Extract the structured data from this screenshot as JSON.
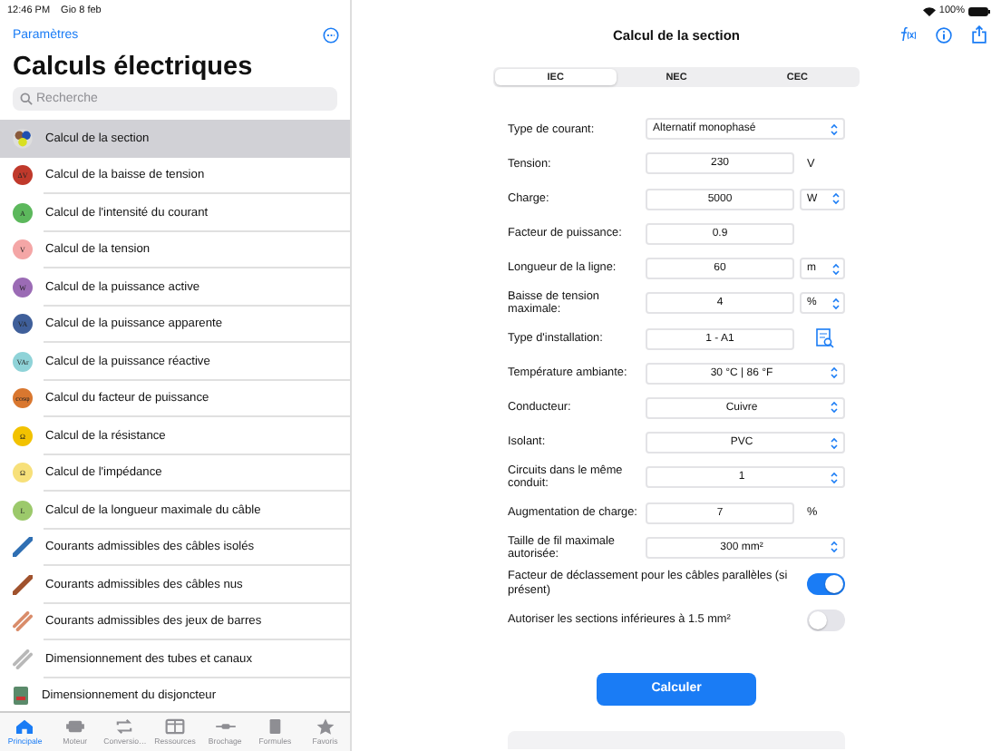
{
  "status_bar": {
    "time": "12:46 PM",
    "date": "Gio 8 feb",
    "battery": "100%"
  },
  "sidebar": {
    "back_link": "Paramètres",
    "title": "Calculs électriques",
    "search": {
      "placeholder": "Recherche"
    },
    "items": [
      {
        "label": "Calcul de la section",
        "kind": "multi",
        "color": "#8a5a3c",
        "selected": true
      },
      {
        "label": "Calcul de la baisse de tension",
        "kind": "badge",
        "symbol": "ΔV",
        "color": "#c0392b",
        "selected": false
      },
      {
        "label": "Calcul de l'intensité du courant",
        "kind": "badge",
        "symbol": "A",
        "color": "#5cb85c",
        "selected": false
      },
      {
        "label": "Calcul de la tension",
        "kind": "badge",
        "symbol": "V",
        "color": "#f4a6a6",
        "selected": false
      },
      {
        "label": "Calcul de la puissance active",
        "kind": "badge",
        "symbol": "W",
        "color": "#9b6bb5",
        "selected": false
      },
      {
        "label": "Calcul de la puissance apparente",
        "kind": "badge",
        "symbol": "VA",
        "color": "#3f5f9a",
        "selected": false
      },
      {
        "label": "Calcul de la puissance réactive",
        "kind": "badge",
        "symbol": "VAr",
        "color": "#8fd3d8",
        "selected": false
      },
      {
        "label": "Calcul du facteur de puissance",
        "kind": "badge",
        "symbol": "cosφ",
        "color": "#d9772f",
        "selected": false
      },
      {
        "label": "Calcul de la résistance",
        "kind": "badge",
        "symbol": "Ω",
        "color": "#f2c200",
        "selected": false
      },
      {
        "label": "Calcul de l'impédance",
        "kind": "badge",
        "symbol": "Ω",
        "color": "#f7e07a",
        "selected": false
      },
      {
        "label": "Calcul de la longueur maximale du câble",
        "kind": "badge",
        "symbol": "L",
        "color": "#9cc96b",
        "selected": false
      },
      {
        "label": "Courants admissibles des câbles isolés",
        "kind": "cable",
        "color": "#2f6fb3",
        "selected": false
      },
      {
        "label": "Courants admissibles des câbles nus",
        "kind": "cable",
        "color": "#a0522d",
        "selected": false
      },
      {
        "label": "Courants admissibles des jeux de barres",
        "kind": "bars",
        "color": "#d98c6a",
        "selected": false
      },
      {
        "label": "Dimensionnement des tubes et canaux",
        "kind": "bars",
        "color": "#b8b8b8",
        "selected": false
      },
      {
        "label": "Dimensionnement du disjoncteur",
        "kind": "breaker",
        "color": "#5a8a6a",
        "selected": false
      }
    ]
  },
  "tab_bar": [
    {
      "label": "Principale",
      "selected": true
    },
    {
      "label": "Moteur",
      "selected": false
    },
    {
      "label": "Conversio…",
      "selected": false
    },
    {
      "label": "Ressources",
      "selected": false
    },
    {
      "label": "Brochage",
      "selected": false
    },
    {
      "label": "Formules",
      "selected": false
    },
    {
      "label": "Favoris",
      "selected": false
    }
  ],
  "main": {
    "title": "Calcul de la section",
    "standards": [
      {
        "label": "IEC",
        "selected": true
      },
      {
        "label": "NEC",
        "selected": false
      },
      {
        "label": "CEC",
        "selected": false
      }
    ],
    "fields": [
      {
        "label": "Type de courant:",
        "kind": "picker",
        "value": "Alternatif monophasé"
      },
      {
        "label": "Tension:",
        "kind": "input",
        "value": "230",
        "unit": "V"
      },
      {
        "label": "Charge:",
        "kind": "input_unit_select",
        "value": "5000",
        "unit": "W"
      },
      {
        "label": "Facteur de puissance:",
        "kind": "input",
        "value": "0.9"
      },
      {
        "label": "Longueur de la ligne:",
        "kind": "input_unit_select",
        "value": "60",
        "unit": "m"
      },
      {
        "label": "Baisse de tension maximale:",
        "kind": "input_unit_select",
        "value": "4",
        "unit": "%"
      },
      {
        "label": "Type d'installation:",
        "kind": "lookup",
        "value": "1 - A1"
      },
      {
        "label": "Température ambiante:",
        "kind": "select",
        "value": "30 °C | 86 °F"
      },
      {
        "label": "Conducteur:",
        "kind": "select",
        "value": "Cuivre"
      },
      {
        "label": "Isolant:",
        "kind": "select",
        "value": "PVC"
      },
      {
        "label": "Circuits dans le même conduit:",
        "kind": "select",
        "value": "1"
      },
      {
        "label": "Augmentation de charge:",
        "kind": "input",
        "value": "7",
        "unit": "%"
      },
      {
        "label": "Taille de fil maximale autorisée:",
        "kind": "select",
        "value": "300 mm²"
      },
      {
        "label": "Facteur de déclassement pour les câbles parallèles (si présent)",
        "kind": "toggle",
        "on": true
      },
      {
        "label": "Autoriser les sections inférieures à 1.5 mm²",
        "kind": "toggle",
        "on": false
      }
    ],
    "button": "Calculer"
  }
}
